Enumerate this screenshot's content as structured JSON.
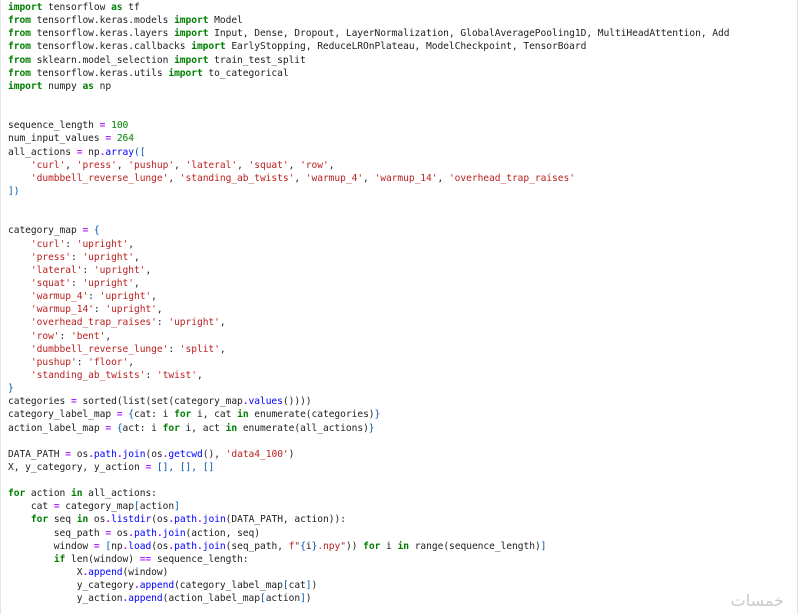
{
  "editor": {
    "lines": [
      [
        [
          "kw",
          "import"
        ],
        [
          "plain",
          " tensorflow "
        ],
        [
          "kw",
          "as"
        ],
        [
          "plain",
          " tf"
        ]
      ],
      [
        [
          "kw",
          "from"
        ],
        [
          "plain",
          " tensorflow.keras.models "
        ],
        [
          "kw",
          "import"
        ],
        [
          "plain",
          " Model"
        ]
      ],
      [
        [
          "kw",
          "from"
        ],
        [
          "plain",
          " tensorflow.keras.layers "
        ],
        [
          "kw",
          "import"
        ],
        [
          "plain",
          " Input, Dense, Dropout, LayerNormalization, GlobalAveragePooling1D, MultiHeadAttention, Add"
        ]
      ],
      [
        [
          "kw",
          "from"
        ],
        [
          "plain",
          " tensorflow.keras.callbacks "
        ],
        [
          "kw",
          "import"
        ],
        [
          "plain",
          " EarlyStopping, ReduceLROnPlateau, ModelCheckpoint, TensorBoard"
        ]
      ],
      [
        [
          "kw",
          "from"
        ],
        [
          "plain",
          " sklearn.model_selection "
        ],
        [
          "kw",
          "import"
        ],
        [
          "plain",
          " train_test_split"
        ]
      ],
      [
        [
          "kw",
          "from"
        ],
        [
          "plain",
          " tensorflow.keras.utils "
        ],
        [
          "kw",
          "import"
        ],
        [
          "plain",
          " to_categorical"
        ]
      ],
      [
        [
          "kw",
          "import"
        ],
        [
          "plain",
          " numpy "
        ],
        [
          "kw",
          "as"
        ],
        [
          "plain",
          " np"
        ]
      ],
      [],
      [],
      [
        [
          "plain",
          "sequence_length "
        ],
        [
          "op",
          "="
        ],
        [
          "plain",
          " "
        ],
        [
          "num",
          "100"
        ]
      ],
      [
        [
          "plain",
          "num_input_values "
        ],
        [
          "op",
          "="
        ],
        [
          "plain",
          " "
        ],
        [
          "num",
          "264"
        ]
      ],
      [
        [
          "plain",
          "all_actions "
        ],
        [
          "op",
          "="
        ],
        [
          "plain",
          " np"
        ],
        [
          "op",
          "."
        ],
        [
          "fn",
          "array"
        ],
        [
          "punct",
          "(["
        ]
      ],
      [
        [
          "plain",
          "    "
        ],
        [
          "str",
          "'curl'"
        ],
        [
          "plain",
          ", "
        ],
        [
          "str",
          "'press'"
        ],
        [
          "plain",
          ", "
        ],
        [
          "str",
          "'pushup'"
        ],
        [
          "plain",
          ", "
        ],
        [
          "str",
          "'lateral'"
        ],
        [
          "plain",
          ", "
        ],
        [
          "str",
          "'squat'"
        ],
        [
          "plain",
          ", "
        ],
        [
          "str",
          "'row'"
        ],
        [
          "plain",
          ","
        ]
      ],
      [
        [
          "plain",
          "    "
        ],
        [
          "str",
          "'dumbbell_reverse_lunge'"
        ],
        [
          "plain",
          ", "
        ],
        [
          "str",
          "'standing_ab_twists'"
        ],
        [
          "plain",
          ", "
        ],
        [
          "str",
          "'warmup_4'"
        ],
        [
          "plain",
          ", "
        ],
        [
          "str",
          "'warmup_14'"
        ],
        [
          "plain",
          ", "
        ],
        [
          "str",
          "'overhead_trap_raises'"
        ]
      ],
      [
        [
          "punct",
          "])"
        ]
      ],
      [],
      [],
      [
        [
          "plain",
          "category_map "
        ],
        [
          "op",
          "="
        ],
        [
          "plain",
          " "
        ],
        [
          "punct",
          "{"
        ]
      ],
      [
        [
          "plain",
          "    "
        ],
        [
          "str",
          "'curl'"
        ],
        [
          "plain",
          ": "
        ],
        [
          "str",
          "'upright'"
        ],
        [
          "plain",
          ","
        ]
      ],
      [
        [
          "plain",
          "    "
        ],
        [
          "str",
          "'press'"
        ],
        [
          "plain",
          ": "
        ],
        [
          "str",
          "'upright'"
        ],
        [
          "plain",
          ","
        ]
      ],
      [
        [
          "plain",
          "    "
        ],
        [
          "str",
          "'lateral'"
        ],
        [
          "plain",
          ": "
        ],
        [
          "str",
          "'upright'"
        ],
        [
          "plain",
          ","
        ]
      ],
      [
        [
          "plain",
          "    "
        ],
        [
          "str",
          "'squat'"
        ],
        [
          "plain",
          ": "
        ],
        [
          "str",
          "'upright'"
        ],
        [
          "plain",
          ","
        ]
      ],
      [
        [
          "plain",
          "    "
        ],
        [
          "str",
          "'warmup_4'"
        ],
        [
          "plain",
          ": "
        ],
        [
          "str",
          "'upright'"
        ],
        [
          "plain",
          ","
        ]
      ],
      [
        [
          "plain",
          "    "
        ],
        [
          "str",
          "'warmup_14'"
        ],
        [
          "plain",
          ": "
        ],
        [
          "str",
          "'upright'"
        ],
        [
          "plain",
          ","
        ]
      ],
      [
        [
          "plain",
          "    "
        ],
        [
          "str",
          "'overhead_trap_raises'"
        ],
        [
          "plain",
          ": "
        ],
        [
          "str",
          "'upright'"
        ],
        [
          "plain",
          ","
        ]
      ],
      [
        [
          "plain",
          "    "
        ],
        [
          "str",
          "'row'"
        ],
        [
          "plain",
          ": "
        ],
        [
          "str",
          "'bent'"
        ],
        [
          "plain",
          ","
        ]
      ],
      [
        [
          "plain",
          "    "
        ],
        [
          "str",
          "'dumbbell_reverse_lunge'"
        ],
        [
          "plain",
          ": "
        ],
        [
          "str",
          "'split'"
        ],
        [
          "plain",
          ","
        ]
      ],
      [
        [
          "plain",
          "    "
        ],
        [
          "str",
          "'pushup'"
        ],
        [
          "plain",
          ": "
        ],
        [
          "str",
          "'floor'"
        ],
        [
          "plain",
          ","
        ]
      ],
      [
        [
          "plain",
          "    "
        ],
        [
          "str",
          "'standing_ab_twists'"
        ],
        [
          "plain",
          ": "
        ],
        [
          "str",
          "'twist'"
        ],
        [
          "plain",
          ","
        ]
      ],
      [
        [
          "punct",
          "}"
        ]
      ],
      [
        [
          "plain",
          "categories "
        ],
        [
          "op",
          "="
        ],
        [
          "plain",
          " sorted(list(set(category_map"
        ],
        [
          "op",
          "."
        ],
        [
          "fn",
          "values"
        ],
        [
          "plain",
          "())))"
        ]
      ],
      [
        [
          "plain",
          "category_label_map "
        ],
        [
          "op",
          "="
        ],
        [
          "plain",
          " "
        ],
        [
          "punct",
          "{"
        ],
        [
          "plain",
          "cat: i "
        ],
        [
          "kw",
          "for"
        ],
        [
          "plain",
          " i, cat "
        ],
        [
          "kw",
          "in"
        ],
        [
          "plain",
          " enumerate(categories)"
        ],
        [
          "punct",
          "}"
        ]
      ],
      [
        [
          "plain",
          "action_label_map "
        ],
        [
          "op",
          "="
        ],
        [
          "plain",
          " "
        ],
        [
          "punct",
          "{"
        ],
        [
          "plain",
          "act: i "
        ],
        [
          "kw",
          "for"
        ],
        [
          "plain",
          " i, act "
        ],
        [
          "kw",
          "in"
        ],
        [
          "plain",
          " enumerate(all_actions)"
        ],
        [
          "punct",
          "}"
        ]
      ],
      [],
      [
        [
          "plain",
          "DATA_PATH "
        ],
        [
          "op",
          "="
        ],
        [
          "plain",
          " os"
        ],
        [
          "op",
          "."
        ],
        [
          "fn",
          "path"
        ],
        [
          "op",
          "."
        ],
        [
          "fn",
          "join"
        ],
        [
          "plain",
          "(os"
        ],
        [
          "op",
          "."
        ],
        [
          "fn",
          "getcwd"
        ],
        [
          "plain",
          "(), "
        ],
        [
          "str",
          "'data4_100'"
        ],
        [
          "plain",
          ")"
        ]
      ],
      [
        [
          "plain",
          "X, y_category, y_action "
        ],
        [
          "op",
          "="
        ],
        [
          "plain",
          " "
        ],
        [
          "punct",
          "[], [], []"
        ]
      ],
      [],
      [
        [
          "kw",
          "for"
        ],
        [
          "plain",
          " action "
        ],
        [
          "kw",
          "in"
        ],
        [
          "plain",
          " all_actions:"
        ]
      ],
      [
        [
          "plain",
          "    cat "
        ],
        [
          "op",
          "="
        ],
        [
          "plain",
          " category_map"
        ],
        [
          "punct",
          "["
        ],
        [
          "plain",
          "action"
        ],
        [
          "punct",
          "]"
        ]
      ],
      [
        [
          "plain",
          "    "
        ],
        [
          "kw",
          "for"
        ],
        [
          "plain",
          " seq "
        ],
        [
          "kw",
          "in"
        ],
        [
          "plain",
          " os"
        ],
        [
          "op",
          "."
        ],
        [
          "fn",
          "listdir"
        ],
        [
          "plain",
          "(os"
        ],
        [
          "op",
          "."
        ],
        [
          "fn",
          "path"
        ],
        [
          "op",
          "."
        ],
        [
          "fn",
          "join"
        ],
        [
          "plain",
          "(DATA_PATH, action)):"
        ]
      ],
      [
        [
          "plain",
          "        seq_path "
        ],
        [
          "op",
          "="
        ],
        [
          "plain",
          " os"
        ],
        [
          "op",
          "."
        ],
        [
          "fn",
          "path"
        ],
        [
          "op",
          "."
        ],
        [
          "fn",
          "join"
        ],
        [
          "plain",
          "(action, seq)"
        ]
      ],
      [
        [
          "plain",
          "        window "
        ],
        [
          "op",
          "="
        ],
        [
          "plain",
          " "
        ],
        [
          "punct",
          "["
        ],
        [
          "plain",
          "np"
        ],
        [
          "op",
          "."
        ],
        [
          "fn",
          "load"
        ],
        [
          "plain",
          "(os"
        ],
        [
          "op",
          "."
        ],
        [
          "fn",
          "path"
        ],
        [
          "op",
          "."
        ],
        [
          "fn",
          "join"
        ],
        [
          "plain",
          "(seq_path, "
        ],
        [
          "str",
          "f\""
        ],
        [
          "punct",
          "{"
        ],
        [
          "plain",
          "i"
        ],
        [
          "punct",
          "}"
        ],
        [
          "str",
          ".npy\""
        ],
        [
          "plain",
          ")) "
        ],
        [
          "kw",
          "for"
        ],
        [
          "plain",
          " i "
        ],
        [
          "kw",
          "in"
        ],
        [
          "plain",
          " range(sequence_length)"
        ],
        [
          "punct",
          "]"
        ]
      ],
      [
        [
          "plain",
          "        "
        ],
        [
          "kw",
          "if"
        ],
        [
          "plain",
          " len(window) "
        ],
        [
          "op",
          "=="
        ],
        [
          "plain",
          " sequence_length:"
        ]
      ],
      [
        [
          "plain",
          "            X"
        ],
        [
          "op",
          "."
        ],
        [
          "fn",
          "append"
        ],
        [
          "plain",
          "(window)"
        ]
      ],
      [
        [
          "plain",
          "            y_category"
        ],
        [
          "op",
          "."
        ],
        [
          "fn",
          "append"
        ],
        [
          "plain",
          "(category_label_map"
        ],
        [
          "punct",
          "["
        ],
        [
          "plain",
          "cat"
        ],
        [
          "punct",
          "]"
        ],
        [
          "plain",
          ")"
        ]
      ],
      [
        [
          "plain",
          "            y_action"
        ],
        [
          "op",
          "."
        ],
        [
          "fn",
          "append"
        ],
        [
          "plain",
          "(action_label_map"
        ],
        [
          "punct",
          "["
        ],
        [
          "plain",
          "action"
        ],
        [
          "punct",
          "]"
        ],
        [
          "plain",
          ")"
        ]
      ]
    ]
  },
  "watermark": {
    "text": "خمسات",
    "icon": "khamsat-logo-icon",
    "color": "#8a8a8a"
  }
}
